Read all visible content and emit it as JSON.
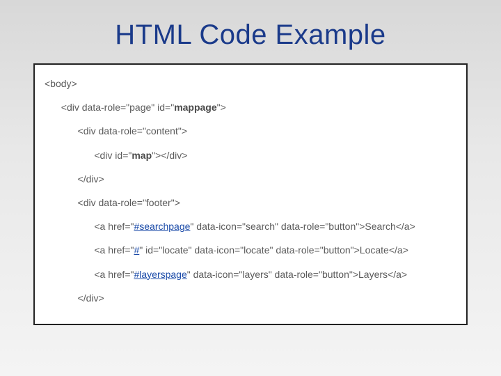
{
  "title": "HTML Code Example",
  "code": {
    "l0": "<body>",
    "l1_pre": "  <div data-role=\"page\" id=\"",
    "l1_bold": "mappage",
    "l1_post": "\">",
    "l2": "    <div data-role=\"content\">",
    "l3_pre": "      <div id=\"",
    "l3_bold": "map",
    "l3_post": "\"></div>",
    "l4": "    </div>",
    "l5": "    <div data-role=\"footer\">",
    "l6_pre": "      <a href=\"",
    "l6_link": "#searchpage",
    "l6_post": "\" data-icon=\"search\" data-role=\"button\">Search</a>",
    "l7_pre": "      <a href=\"",
    "l7_link": "#",
    "l7_post": "\" id=\"locate\" data-icon=\"locate\" data-role=\"button\">Locate</a>",
    "l8_pre": "      <a href=\"",
    "l8_link": "#layerspage",
    "l8_post": "\" data-icon=\"layers\" data-role=\"button\">Layers</a>",
    "l9": "    </div>"
  }
}
